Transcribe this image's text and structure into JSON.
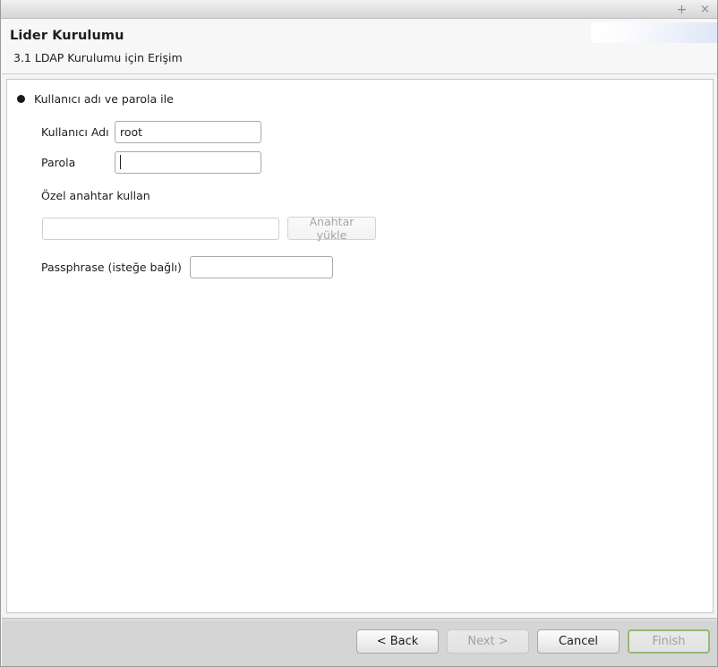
{
  "titlebar": {
    "maximize_glyph": "+",
    "close_glyph": "×"
  },
  "header": {
    "title": "Lider Kurulumu",
    "subtitle": "3.1 LDAP Kurulumu için Erişim"
  },
  "form": {
    "radio_option": {
      "label": "Kullanıcı adı ve parola ile",
      "selected": true
    },
    "username": {
      "label": "Kullanıcı Adı",
      "value": "root"
    },
    "password": {
      "label": "Parola",
      "value": ""
    },
    "private_key_section": {
      "label": "Özel anahtar kullan",
      "path_value": "",
      "load_button": "Anahtar yükle"
    },
    "passphrase": {
      "label": "Passphrase (isteğe bağlı)",
      "value": ""
    }
  },
  "footer": {
    "back": "< Back",
    "next": "Next >",
    "cancel": "Cancel",
    "finish": "Finish"
  },
  "colors": {
    "default_button_border": "#94ba74",
    "footer_background": "#d5d5d5",
    "panel_background": "#ffffff"
  }
}
